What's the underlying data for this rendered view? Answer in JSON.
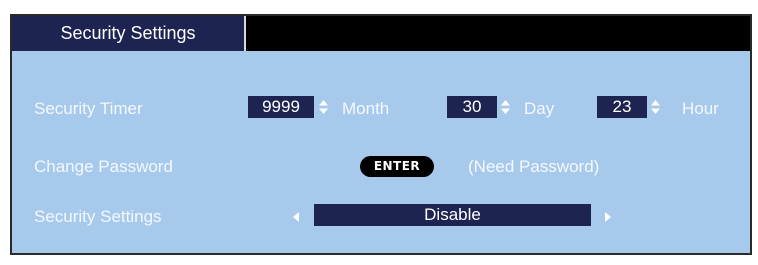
{
  "panel": {
    "title": "Security Settings"
  },
  "rows": {
    "timer": {
      "label": "Security Timer",
      "month_value": "9999",
      "month_unit": "Month",
      "day_value": "30",
      "day_unit": "Day",
      "hour_value": "23",
      "hour_unit": "Hour"
    },
    "password": {
      "label": "Change Password",
      "button_label": "ENTER",
      "note": "(Need Password)"
    },
    "security": {
      "label": "Security Settings",
      "value": "Disable"
    }
  },
  "colors": {
    "panel_bg": "#a7c9ec",
    "value_box": "#1d2452",
    "title_bar": "#000000"
  },
  "icons": {
    "spinner": "up-down-arrows-icon",
    "left": "left-arrow-icon",
    "right": "right-arrow-icon"
  }
}
